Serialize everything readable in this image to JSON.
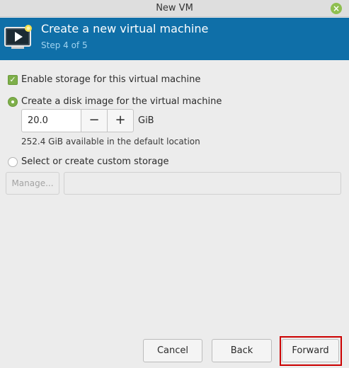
{
  "window": {
    "title": "New VM",
    "close_glyph": "×"
  },
  "header": {
    "title": "Create a new virtual machine",
    "step": "Step 4 of 5",
    "icon": "vm-monitor-icon",
    "bg_color": "#0f6fa8"
  },
  "storage": {
    "enable_label": "Enable storage for this virtual machine",
    "enable_checked": true,
    "disk_image_label": "Create a disk image for the virtual machine",
    "disk_image_selected": true,
    "size_value": "20.0",
    "minus_glyph": "−",
    "plus_glyph": "+",
    "unit": "GiB",
    "available": "252.4 GiB available in the default location",
    "custom_label": "Select or create custom storage",
    "custom_selected": false,
    "manage_label": "Manage...",
    "custom_path_value": ""
  },
  "buttons": {
    "cancel": "Cancel",
    "back": "Back",
    "forward": "Forward"
  },
  "colors": {
    "accent_green": "#7eaf4a",
    "highlight_red": "#cc0000"
  }
}
